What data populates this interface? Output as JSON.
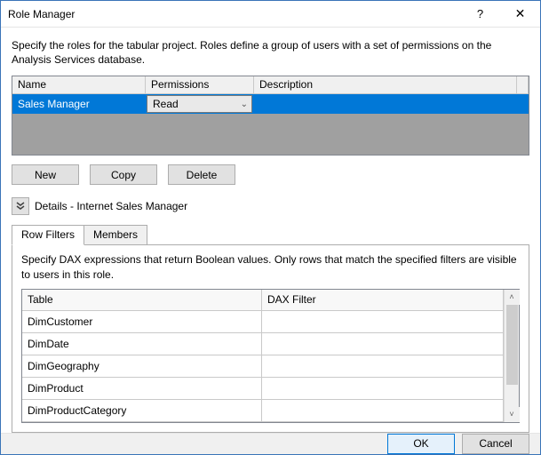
{
  "window": {
    "title": "Role Manager"
  },
  "intro": "Specify the roles for the tabular project. Roles define a group of users with a set of permissions on the Analysis Services database.",
  "roles_grid": {
    "headers": {
      "name": "Name",
      "permissions": "Permissions",
      "description": "Description"
    },
    "rows": [
      {
        "name": "Sales Manager",
        "permission": "Read",
        "description": ""
      }
    ]
  },
  "buttons": {
    "new": "New",
    "copy": "Copy",
    "delete": "Delete"
  },
  "details": {
    "label": "Details - Internet Sales Manager"
  },
  "tabs": {
    "row_filters": "Row Filters",
    "members": "Members",
    "active": "row_filters"
  },
  "tab_intro": "Specify DAX expressions that return Boolean values. Only rows that match the specified filters are visible to users in this role.",
  "filter_grid": {
    "headers": {
      "table": "Table",
      "dax": "DAX Filter"
    },
    "rows": [
      {
        "table": "DimCustomer",
        "dax": ""
      },
      {
        "table": "DimDate",
        "dax": ""
      },
      {
        "table": "DimGeography",
        "dax": ""
      },
      {
        "table": "DimProduct",
        "dax": ""
      },
      {
        "table": "DimProductCategory",
        "dax": ""
      }
    ]
  },
  "footer": {
    "ok": "OK",
    "cancel": "Cancel"
  }
}
